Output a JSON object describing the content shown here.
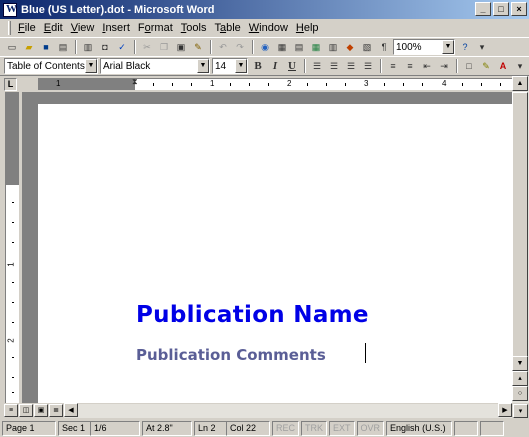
{
  "window": {
    "title": "Blue (US Letter).dot - Microsoft Word",
    "minimize": "_",
    "restore": "□",
    "close": "×"
  },
  "menu": [
    {
      "key": "F",
      "rest": "ile"
    },
    {
      "key": "E",
      "rest": "dit"
    },
    {
      "key": "V",
      "rest": "iew"
    },
    {
      "key": "I",
      "rest": "nsert"
    },
    {
      "pre": "F",
      "key": "o",
      "rest": "rmat"
    },
    {
      "key": "T",
      "rest": "ools"
    },
    {
      "pre": "T",
      "key": "a",
      "rest": "ble"
    },
    {
      "key": "W",
      "rest": "indow"
    },
    {
      "key": "H",
      "rest": "elp"
    }
  ],
  "toolbar": {
    "zoom": "100%",
    "style": "Table of Contents H",
    "font": "Arial Black",
    "size": "14",
    "bold": "B",
    "italic": "I",
    "underline": "U",
    "pilcrow": "¶"
  },
  "ruler": {
    "numbers": [
      "1",
      "1",
      "2",
      "3",
      "4"
    ],
    "tab_selector": "L"
  },
  "vruler": {
    "numbers": [
      "1",
      "2"
    ]
  },
  "document": {
    "publication_name": "Publication Name",
    "publication_comments": "Publication Comments"
  },
  "status": {
    "page": "Page 1",
    "sec": "Sec 1",
    "pages": "1/6",
    "at": "At 2.8\"",
    "ln": "Ln 2",
    "col": "Col 22",
    "rec": "REC",
    "trk": "TRK",
    "ext": "EXT",
    "ovr": "OVR",
    "language": "English (U.S.)"
  },
  "colors": {
    "title_blue": "#0000e6",
    "comments_slate": "#5a5e96",
    "titlebar": "#0a246a"
  }
}
